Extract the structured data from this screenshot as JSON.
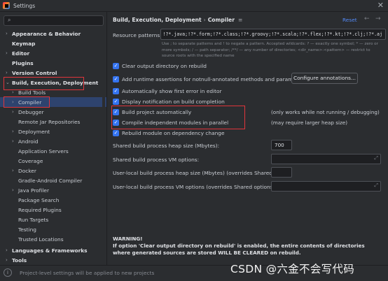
{
  "window": {
    "title": "Settings"
  },
  "sidebar": {
    "search_placeholder": "",
    "items": [
      {
        "label": "Appearance & Behavior",
        "bold": true,
        "arrow": "›"
      },
      {
        "label": "Keymap",
        "bold": true,
        "arrow": ""
      },
      {
        "label": "Editor",
        "bold": true,
        "arrow": "›"
      },
      {
        "label": "Plugins",
        "bold": true,
        "arrow": ""
      },
      {
        "label": "Version Control",
        "bold": true,
        "arrow": "›"
      },
      {
        "label": "Build, Execution, Deployment",
        "bold": true,
        "arrow": "⌄"
      },
      {
        "label": "Build Tools",
        "bold": false,
        "arrow": "›"
      },
      {
        "label": "Compiler",
        "bold": false,
        "arrow": "›"
      },
      {
        "label": "Debugger",
        "bold": false,
        "arrow": "›"
      },
      {
        "label": "Remote Jar Repositories",
        "bold": false,
        "arrow": ""
      },
      {
        "label": "Deployment",
        "bold": false,
        "arrow": "›"
      },
      {
        "label": "Android",
        "bold": false,
        "arrow": "›"
      },
      {
        "label": "Application Servers",
        "bold": false,
        "arrow": ""
      },
      {
        "label": "Coverage",
        "bold": false,
        "arrow": ""
      },
      {
        "label": "Docker",
        "bold": false,
        "arrow": "›"
      },
      {
        "label": "Gradle-Android Compiler",
        "bold": false,
        "arrow": ""
      },
      {
        "label": "Java Profiler",
        "bold": false,
        "arrow": "›"
      },
      {
        "label": "Package Search",
        "bold": false,
        "arrow": ""
      },
      {
        "label": "Required Plugins",
        "bold": false,
        "arrow": ""
      },
      {
        "label": "Run Targets",
        "bold": false,
        "arrow": ""
      },
      {
        "label": "Testing",
        "bold": false,
        "arrow": ""
      },
      {
        "label": "Trusted Locations",
        "bold": false,
        "arrow": ""
      },
      {
        "label": "Languages & Frameworks",
        "bold": true,
        "arrow": "›"
      },
      {
        "label": "Tools",
        "bold": true,
        "arrow": "›"
      }
    ]
  },
  "header": {
    "crumb_parent": "Build, Execution, Deployment",
    "crumb_sep": "›",
    "crumb_current": "Compiler",
    "menu_glyph": "≡",
    "reset_label": "Reset",
    "back_glyph": "←",
    "forward_glyph": "→"
  },
  "resource_patterns": {
    "label": "Resource patterns:",
    "value": "!?*.java;!?*.form;!?*.class;!?*.groovy;!?*.scala;!?*.flex;!?*.kt;!?*.clj;!?*.aj",
    "help": "Use ; to separate patterns and ! to negate a pattern. Accepted wildcards: ? — exactly one symbol; * — zero or more symbols; / — path separator; /**/ — any number of directories; <dir_name>:<pattern> — restrict to source roots with the specified name"
  },
  "options": {
    "clear_output": {
      "label": "Clear output directory on rebuild",
      "checked": true
    },
    "assertions": {
      "label": "Add runtime assertions for notnull-annotated methods and parameters",
      "checked": true
    },
    "configure_button": "Configure annotations...",
    "show_error": {
      "label": "Automatically show first error in editor",
      "checked": true
    },
    "notification": {
      "label": "Display notification on build completion",
      "checked": true
    },
    "auto_build": {
      "label": "Build project automatically",
      "checked": true,
      "hint": "(only works while not running / debugging)"
    },
    "parallel": {
      "label": "Compile independent modules in parallel",
      "checked": true,
      "hint": "(may require larger heap size)"
    },
    "rebuild_dep": {
      "label": "Rebuild module on dependency change",
      "checked": true
    }
  },
  "fields": {
    "heap_label": "Shared build process heap size (Mbytes):",
    "heap_value": "700",
    "vm_label": "Shared build process VM options:",
    "user_heap_label": "User-local build process heap size (Mbytes) (overrides Shared size):",
    "user_vm_label": "User-local build process VM options (overrides Shared options):",
    "expand_glyph": "⤢"
  },
  "warning": {
    "title": "WARNING!",
    "text": "If option 'Clear output directory on rebuild' is enabled, the entire contents of directories where generated sources are stored WILL BE CLEARED on rebuild."
  },
  "footer": {
    "info_glyph": "i",
    "text": "Project-level settings will be applied to new projects"
  },
  "watermark": "CSDN @六金不会写代码",
  "colors": {
    "accent": "#3574f0",
    "link": "#548af7",
    "annotation": "#e0353b",
    "selection": "#2e436e"
  }
}
